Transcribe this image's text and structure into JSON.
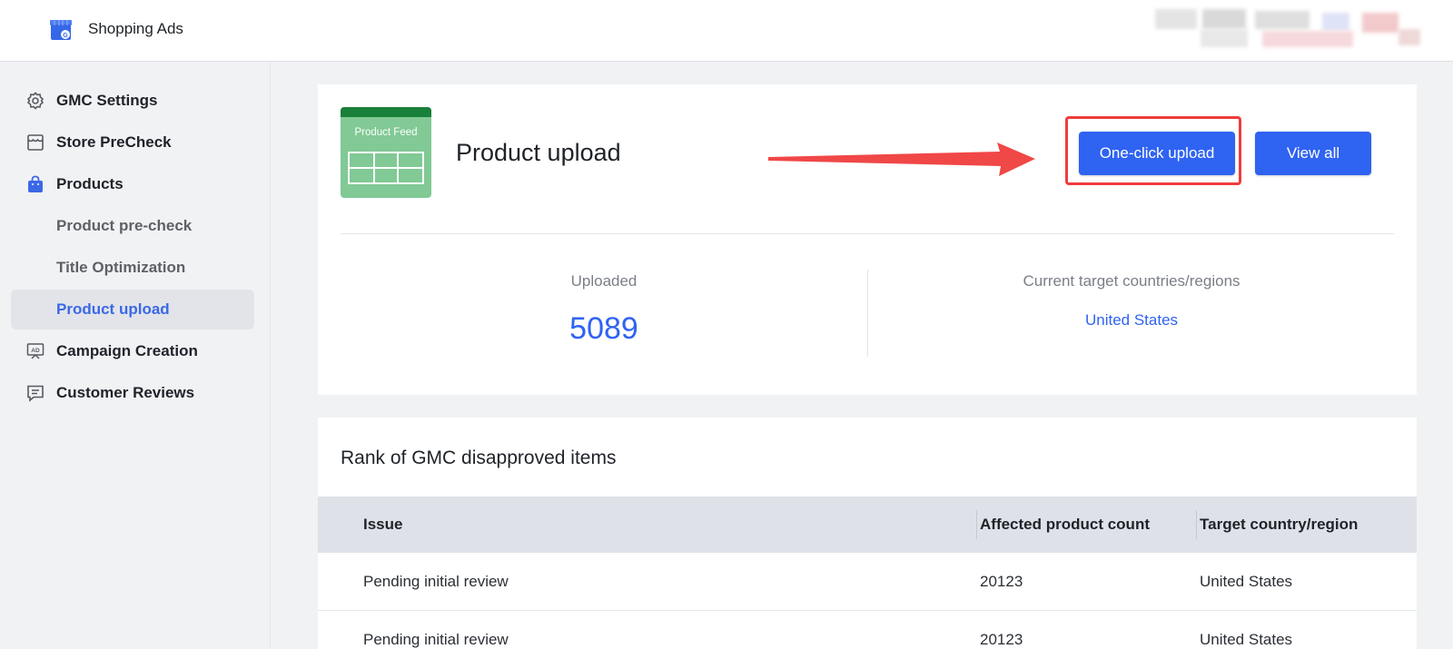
{
  "app": {
    "title": "Shopping Ads"
  },
  "sidebar": {
    "items": [
      {
        "label": "GMC Settings",
        "icon": "gear-icon"
      },
      {
        "label": "Store PreCheck",
        "icon": "store-icon"
      },
      {
        "label": "Products",
        "icon": "shopping-bag-icon"
      },
      {
        "label": "Product pre-check"
      },
      {
        "label": "Title Optimization"
      },
      {
        "label": "Product upload",
        "active": true
      },
      {
        "label": "Campaign Creation",
        "icon": "ad-board-icon"
      },
      {
        "label": "Customer Reviews",
        "icon": "review-icon"
      }
    ]
  },
  "upload_card": {
    "icon_text": "Product Feed",
    "title": "Product upload",
    "one_click_label": "One-click upload",
    "view_all_label": "View all",
    "uploaded_label": "Uploaded",
    "uploaded_value": "5089",
    "countries_label": "Current target countries/regions",
    "countries_value": "United States"
  },
  "rank_card": {
    "title": "Rank of GMC disapproved items",
    "columns": [
      "Issue",
      "Affected product count",
      "Target country/region"
    ],
    "rows": [
      {
        "issue": "Pending initial review",
        "count": "20123",
        "country": "United States"
      },
      {
        "issue": "Pending initial review",
        "count": "20123",
        "country": "United States"
      }
    ]
  },
  "colors": {
    "accent": "#2f63f2",
    "highlight": "#f03c3c",
    "feed_green": "#81c995"
  }
}
